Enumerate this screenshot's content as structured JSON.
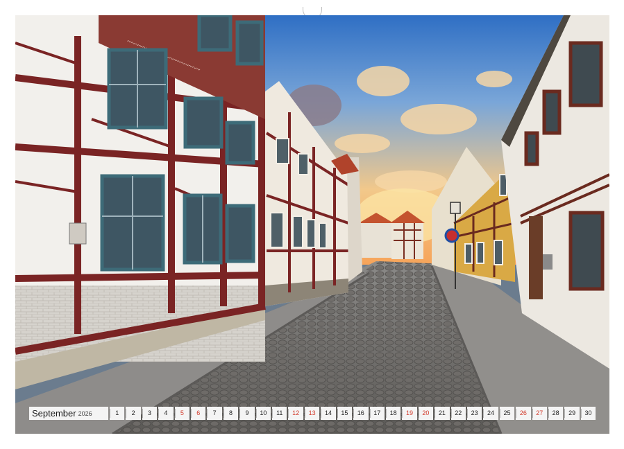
{
  "calendar": {
    "month": "September",
    "year": "2026",
    "days": [
      {
        "n": "1",
        "w": false
      },
      {
        "n": "2",
        "w": false
      },
      {
        "n": "3",
        "w": false
      },
      {
        "n": "4",
        "w": false
      },
      {
        "n": "5",
        "w": true
      },
      {
        "n": "6",
        "w": true
      },
      {
        "n": "7",
        "w": false
      },
      {
        "n": "8",
        "w": false
      },
      {
        "n": "9",
        "w": false
      },
      {
        "n": "10",
        "w": false
      },
      {
        "n": "11",
        "w": false
      },
      {
        "n": "12",
        "w": true
      },
      {
        "n": "13",
        "w": true
      },
      {
        "n": "14",
        "w": false
      },
      {
        "n": "15",
        "w": false
      },
      {
        "n": "16",
        "w": false
      },
      {
        "n": "17",
        "w": false
      },
      {
        "n": "18",
        "w": false
      },
      {
        "n": "19",
        "w": true
      },
      {
        "n": "20",
        "w": true
      },
      {
        "n": "21",
        "w": false
      },
      {
        "n": "22",
        "w": false
      },
      {
        "n": "23",
        "w": false
      },
      {
        "n": "24",
        "w": false
      },
      {
        "n": "25",
        "w": false
      },
      {
        "n": "26",
        "w": true
      },
      {
        "n": "27",
        "w": true
      },
      {
        "n": "28",
        "w": false
      },
      {
        "n": "29",
        "w": false
      },
      {
        "n": "30",
        "w": false
      }
    ]
  },
  "colors": {
    "weekend": "#d23a2a",
    "weekday": "#222222",
    "cell_background": "#f4f4f4",
    "timber_frame": "#7a2424",
    "window_frame": "#3d6b78"
  },
  "photo": {
    "subject": "half-timbered houses along a cobblestone street"
  }
}
